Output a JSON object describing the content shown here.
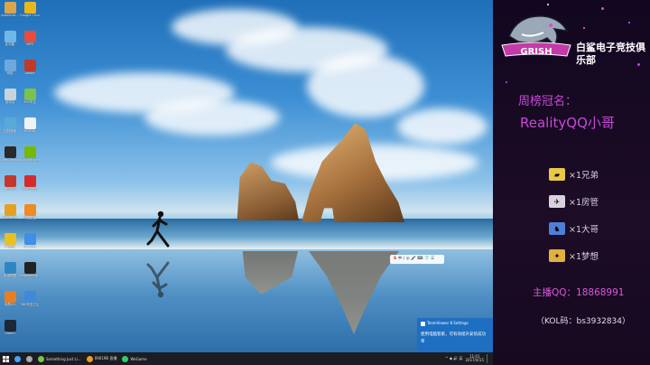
{
  "desktop": {
    "icons_col1": [
      {
        "label": "Administr...",
        "color": "#d9a64a"
      },
      {
        "label": "此电脑",
        "color": "#6fb7e8"
      },
      {
        "label": "网络",
        "color": "#6fa8e0"
      },
      {
        "label": "回收站",
        "color": "#c8d4dc"
      },
      {
        "label": "控制面板",
        "color": "#58a8d8"
      },
      {
        "label": "Open Broadcast...",
        "color": "#2a2a2a"
      },
      {
        "label": "腾讯QQ",
        "color": "#c0392b"
      },
      {
        "label": "WeGame",
        "color": "#e6a020"
      },
      {
        "label": "YY语音",
        "color": "#e8c020"
      },
      {
        "label": "英雄联盟",
        "color": "#2e86c1"
      },
      {
        "label": "网易UU",
        "color": "#e67e22"
      },
      {
        "label": "Steam",
        "color": "#1b2838"
      }
    ],
    "icons_col2": [
      {
        "label": "Google Chrome",
        "color": "#e8b81a"
      },
      {
        "label": "WPS",
        "color": "#e74c3c"
      },
      {
        "label": "Adobe",
        "color": "#c0392b"
      },
      {
        "label": "360安全",
        "color": "#7cc34a"
      },
      {
        "label": "NVIDIA",
        "color": "#eef2f5"
      },
      {
        "label": "Nvidia Experience",
        "color": "#76b900"
      },
      {
        "label": "网易云音乐",
        "color": "#d62b2b"
      },
      {
        "label": "斗鱼直播",
        "color": "#f08a24"
      },
      {
        "label": "Thunder",
        "color": "#3f8ee8"
      },
      {
        "label": "NeteaseGame",
        "color": "#222222"
      },
      {
        "label": "360安全卫士",
        "color": "#3e8ad8"
      }
    ],
    "sogou_text": "中丿◎ 🎤 ⌨ 👕 ☰",
    "sogou_brand": "S",
    "notification": {
      "app": "TeamViewer 8 Settings",
      "message": "使用电脑管家，可有效提升安装成功率"
    }
  },
  "taskbar": {
    "items": [
      {
        "label": "",
        "color": "#4aa3ff"
      },
      {
        "label": "",
        "color": "#aaaaaa"
      },
      {
        "label": "Something Just Li...",
        "color": "#7cc34a"
      },
      {
        "label": "09019B 直播",
        "color": "#e6a020"
      },
      {
        "label": "WeGame",
        "color": "#2ecc71"
      }
    ],
    "tray_icons": "^ ◆ 🔊 英",
    "time": "11:01",
    "date": "2017/4/15"
  },
  "panel": {
    "club_name": "白鲨电子竞技俱乐部",
    "logo_text": "GRISH",
    "weekly_title": "周榜冠名：",
    "champion": "RealityQQ小哥",
    "tiers": [
      {
        "text": "×1兄弟",
        "color": "#e8c84a",
        "glyph": "▰"
      },
      {
        "text": "×1房管",
        "color": "#d9d2dc",
        "glyph": "✈"
      },
      {
        "text": "×1大哥",
        "color": "#4d7fd8",
        "glyph": "♞"
      },
      {
        "text": "×1梦想",
        "color": "#e0b040",
        "glyph": "✦"
      }
    ],
    "host": "主播QQ：18868991",
    "kol": "（KOL码：bs3932834）"
  }
}
